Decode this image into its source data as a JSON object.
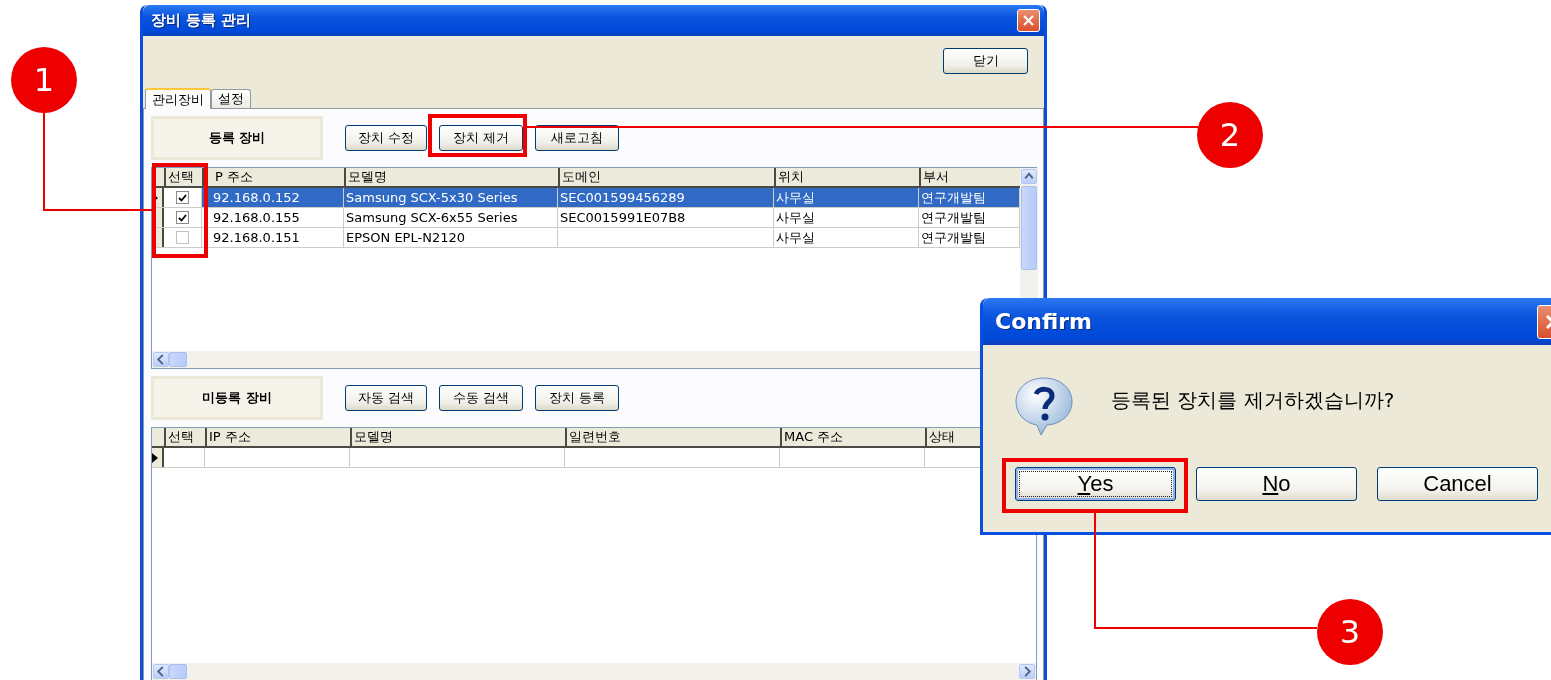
{
  "window": {
    "title": "장비 등록 관리"
  },
  "toolbar": {
    "buttons": [
      "닫기"
    ]
  },
  "tabs": [
    {
      "label": "관리장비",
      "selected": true
    },
    {
      "label": "설정",
      "selected": false
    }
  ],
  "registered": {
    "label": "등록 장비",
    "buttons": [
      "장치 수정",
      "장치 제거",
      "새로고침"
    ],
    "check_column": "선택",
    "columns": [
      "P 주소",
      "모델명",
      "도메인",
      "위치",
      "부서"
    ],
    "rows": [
      {
        "current": true,
        "selected": true,
        "checked": true,
        "cells": [
          "92.168.0.152",
          "Samsung SCX-5x30 Series",
          "SEC001599456289",
          "사무실",
          "연구개발팀"
        ]
      },
      {
        "current": false,
        "selected": false,
        "checked": true,
        "cells": [
          "92.168.0.155",
          "Samsung SCX-6x55 Series",
          "SEC0015991E07B8",
          "사무실",
          "연구개발팀"
        ]
      },
      {
        "current": false,
        "selected": false,
        "checked": false,
        "cells": [
          "92.168.0.151",
          "EPSON EPL-N2120",
          "",
          "사무실",
          "연구개발팀"
        ]
      }
    ]
  },
  "unregistered": {
    "label": "미등록 장비",
    "buttons": [
      "자동 검색",
      "수동 검색",
      "장치 등록"
    ],
    "check_column": "선택",
    "columns": [
      "IP 주소",
      "모델명",
      "일련번호",
      "MAC 주소",
      "상태"
    ],
    "rows": [
      {
        "current": true
      }
    ]
  },
  "dialog": {
    "title": "Confirm",
    "message": "등록된 장치를 제거하겠습니까?",
    "buttons": [
      {
        "label": "Yes",
        "mnemonic": true,
        "focused": true
      },
      {
        "label": "No",
        "mnemonic": true,
        "focused": false
      },
      {
        "label": "Cancel",
        "mnemonic": false,
        "focused": false
      }
    ]
  },
  "callouts": [
    {
      "label": "1"
    },
    {
      "label": "2"
    },
    {
      "label": "3"
    }
  ]
}
